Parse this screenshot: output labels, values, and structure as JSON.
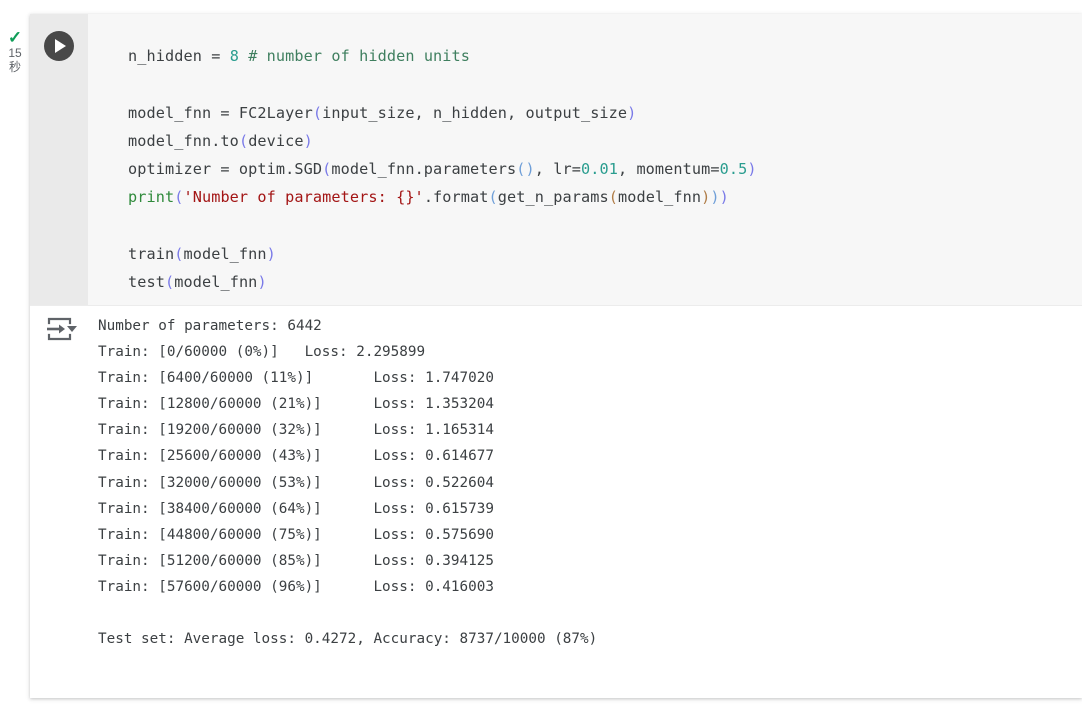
{
  "gutter": {
    "status_icon": "check-icon",
    "elapsed_value": "15",
    "elapsed_unit": "秒"
  },
  "code_cell": {
    "run_icon": "play-icon",
    "lines": [
      {
        "tokens": [
          {
            "t": "n_hidden = ",
            "c": "plain"
          },
          {
            "t": "8",
            "c": "num"
          },
          {
            "t": " ",
            "c": "plain"
          },
          {
            "t": "# number of hidden units",
            "c": "comment"
          }
        ]
      },
      {
        "tokens": [
          {
            "t": "",
            "c": "plain"
          }
        ]
      },
      {
        "tokens": [
          {
            "t": "model_fnn = FC2Layer",
            "c": "plain"
          },
          {
            "t": "(",
            "c": "paren1"
          },
          {
            "t": "input_size, n_hidden, output_size",
            "c": "plain"
          },
          {
            "t": ")",
            "c": "paren1"
          }
        ]
      },
      {
        "tokens": [
          {
            "t": "model_fnn.to",
            "c": "plain"
          },
          {
            "t": "(",
            "c": "paren1"
          },
          {
            "t": "device",
            "c": "plain"
          },
          {
            "t": ")",
            "c": "paren1"
          }
        ]
      },
      {
        "tokens": [
          {
            "t": "optimizer = optim.SGD",
            "c": "plain"
          },
          {
            "t": "(",
            "c": "paren1"
          },
          {
            "t": "model_fnn.parameters",
            "c": "plain"
          },
          {
            "t": "()",
            "c": "paren2"
          },
          {
            "t": ", lr=",
            "c": "plain"
          },
          {
            "t": "0.01",
            "c": "num"
          },
          {
            "t": ", momentum=",
            "c": "plain"
          },
          {
            "t": "0.5",
            "c": "num"
          },
          {
            "t": ")",
            "c": "paren1"
          }
        ]
      },
      {
        "tokens": [
          {
            "t": "print",
            "c": "builtin"
          },
          {
            "t": "(",
            "c": "paren1"
          },
          {
            "t": "'Number of parameters: {}'",
            "c": "string"
          },
          {
            "t": ".format",
            "c": "plain"
          },
          {
            "t": "(",
            "c": "paren2"
          },
          {
            "t": "get_n_params",
            "c": "plain"
          },
          {
            "t": "(",
            "c": "paren3"
          },
          {
            "t": "model_fnn",
            "c": "plain"
          },
          {
            "t": ")",
            "c": "paren3"
          },
          {
            "t": ")",
            "c": "paren2"
          },
          {
            "t": ")",
            "c": "paren1"
          }
        ]
      },
      {
        "tokens": [
          {
            "t": "",
            "c": "plain"
          }
        ]
      },
      {
        "tokens": [
          {
            "t": "train",
            "c": "plain"
          },
          {
            "t": "(",
            "c": "paren1"
          },
          {
            "t": "model_fnn",
            "c": "plain"
          },
          {
            "t": ")",
            "c": "paren1"
          }
        ]
      },
      {
        "tokens": [
          {
            "t": "test",
            "c": "plain"
          },
          {
            "t": "(",
            "c": "paren1"
          },
          {
            "t": "model_fnn",
            "c": "plain"
          },
          {
            "t": ")",
            "c": "paren1"
          }
        ]
      }
    ]
  },
  "output_cell": {
    "icon": "output-toggle-icon",
    "text": "Number of parameters: 6442\nTrain: [0/60000 (0%)]\tLoss: 2.295899\nTrain: [6400/60000 (11%)]\tLoss: 1.747020\nTrain: [12800/60000 (21%)]\tLoss: 1.353204\nTrain: [19200/60000 (32%)]\tLoss: 1.165314\nTrain: [25600/60000 (43%)]\tLoss: 0.614677\nTrain: [32000/60000 (53%)]\tLoss: 0.522604\nTrain: [38400/60000 (64%)]\tLoss: 0.615739\nTrain: [44800/60000 (75%)]\tLoss: 0.575690\nTrain: [51200/60000 (85%)]\tLoss: 0.394125\nTrain: [57600/60000 (96%)]\tLoss: 0.416003\n\nTest set: Average loss: 0.4272, Accuracy: 8737/10000 (87%)"
  },
  "colors": {
    "accent_green": "#0f9d58",
    "comment": "#3f7f5f",
    "number": "#2a9d8f",
    "string": "#a31515",
    "builtin": "#2f8a3b",
    "text": "#3c4043",
    "code_bg": "#f7f7f7",
    "gutter_bg": "#eaeaea",
    "output_bg": "#ffffff"
  }
}
